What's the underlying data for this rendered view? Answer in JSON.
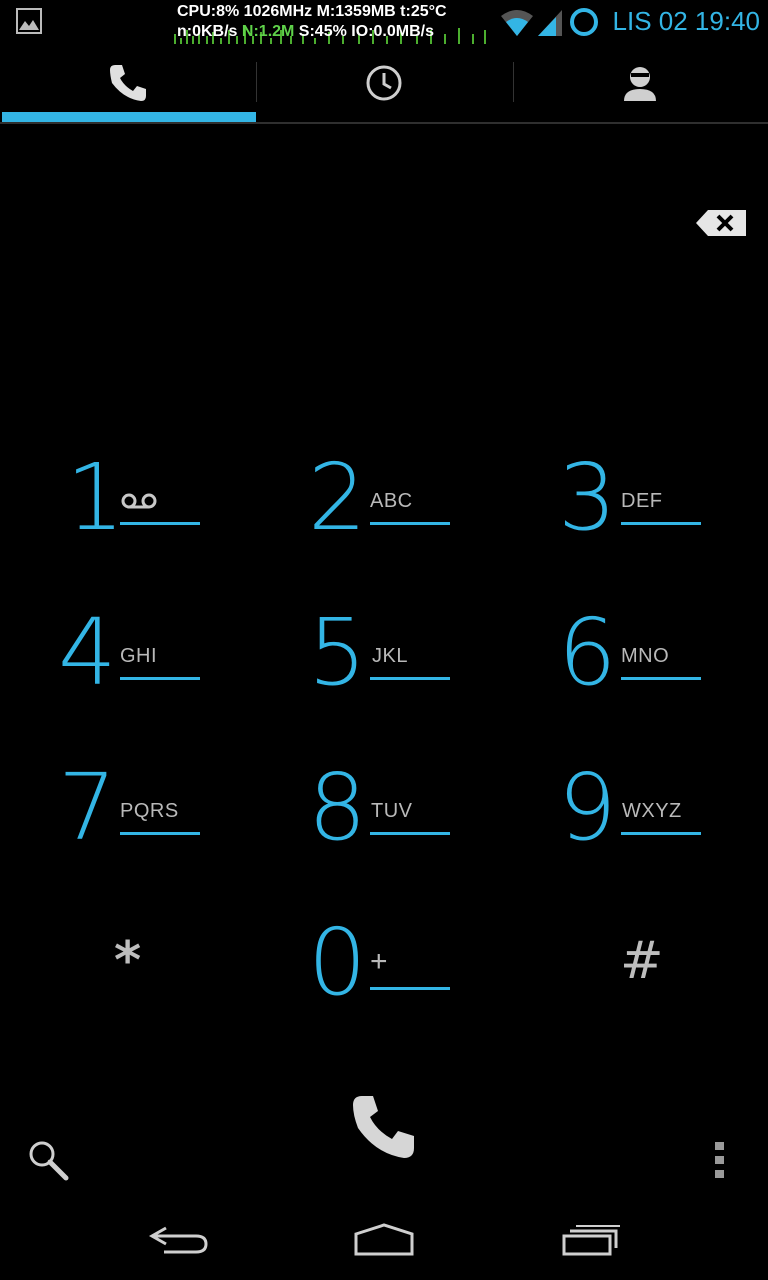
{
  "status_bar": {
    "stats_line1": "CPU:8% 1026MHz M:1359MB t:25°C",
    "stats_line2_a": "n:0KB/s ",
    "stats_line2_b": "N:1.2M",
    "stats_line2_c": " S:45% IO:0.0MB/s",
    "clock": "LIS 02 19:40",
    "icons": [
      "image-icon",
      "wifi-icon",
      "signal-icon",
      "sync-ring-icon"
    ]
  },
  "tabs": [
    {
      "name": "dialer",
      "icon": "phone-icon",
      "selected": true
    },
    {
      "name": "call-log",
      "icon": "clock-icon",
      "selected": false
    },
    {
      "name": "contacts",
      "icon": "person-icon",
      "selected": false
    }
  ],
  "keypad": {
    "k1": {
      "digit": "1",
      "letters": ""
    },
    "k2": {
      "digit": "2",
      "letters": "ABC"
    },
    "k3": {
      "digit": "3",
      "letters": "DEF"
    },
    "k4": {
      "digit": "4",
      "letters": "GHI"
    },
    "k5": {
      "digit": "5",
      "letters": "JKL"
    },
    "k6": {
      "digit": "6",
      "letters": "MNO"
    },
    "k7": {
      "digit": "7",
      "letters": "PQRS"
    },
    "k8": {
      "digit": "8",
      "letters": "TUV"
    },
    "k9": {
      "digit": "9",
      "letters": "WXYZ"
    },
    "kstar": {
      "symbol": "*"
    },
    "k0": {
      "digit": "0",
      "letters": "+"
    },
    "khash": {
      "symbol": "#"
    }
  },
  "colors": {
    "accent": "#33b5e5",
    "secondary_text": "#b9b9b9",
    "background": "#000000"
  }
}
